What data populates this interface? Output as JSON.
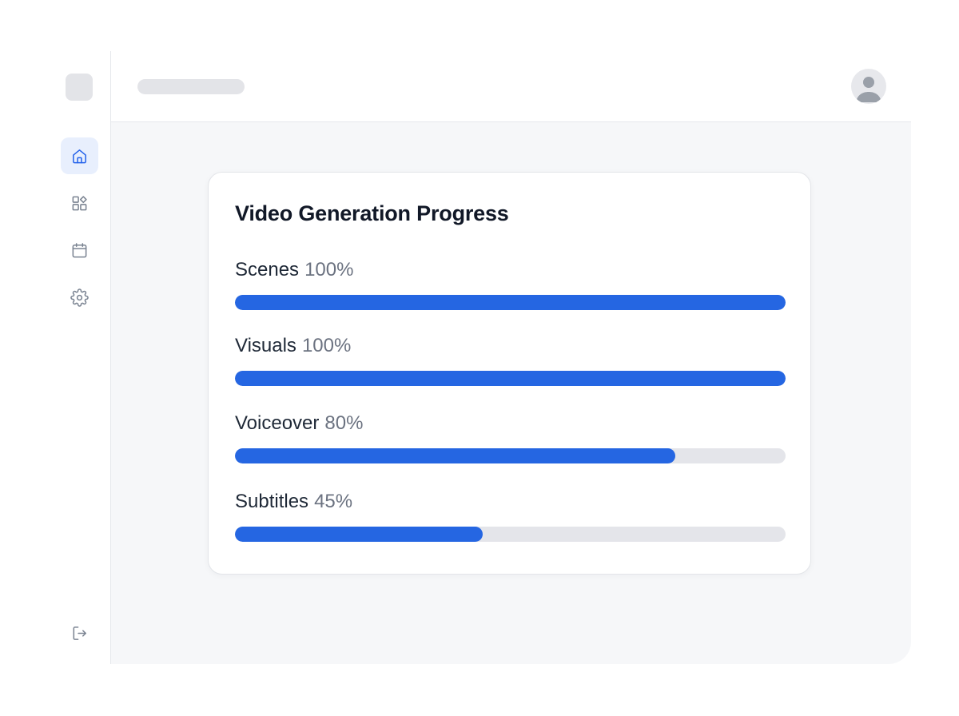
{
  "card": {
    "title": "Video Generation Progress",
    "items": [
      {
        "label": "Scenes",
        "percent_text": "100%",
        "value": 100
      },
      {
        "label": "Visuals",
        "percent_text": "100%",
        "value": 100
      },
      {
        "label": "Voiceover",
        "percent_text": "80%",
        "value": 80
      },
      {
        "label": "Subtitles",
        "percent_text": "45%",
        "value": 45
      }
    ]
  },
  "sidebar": {
    "items": [
      {
        "icon": "home-icon",
        "active": true
      },
      {
        "icon": "grid-icon",
        "active": false
      },
      {
        "icon": "calendar-icon",
        "active": false
      },
      {
        "icon": "gear-icon",
        "active": false
      }
    ],
    "footer_icon": "logout-icon"
  },
  "colors": {
    "accent": "#2566e2",
    "track": "#e4e5ea",
    "active_nav_bg": "#e8effd"
  }
}
